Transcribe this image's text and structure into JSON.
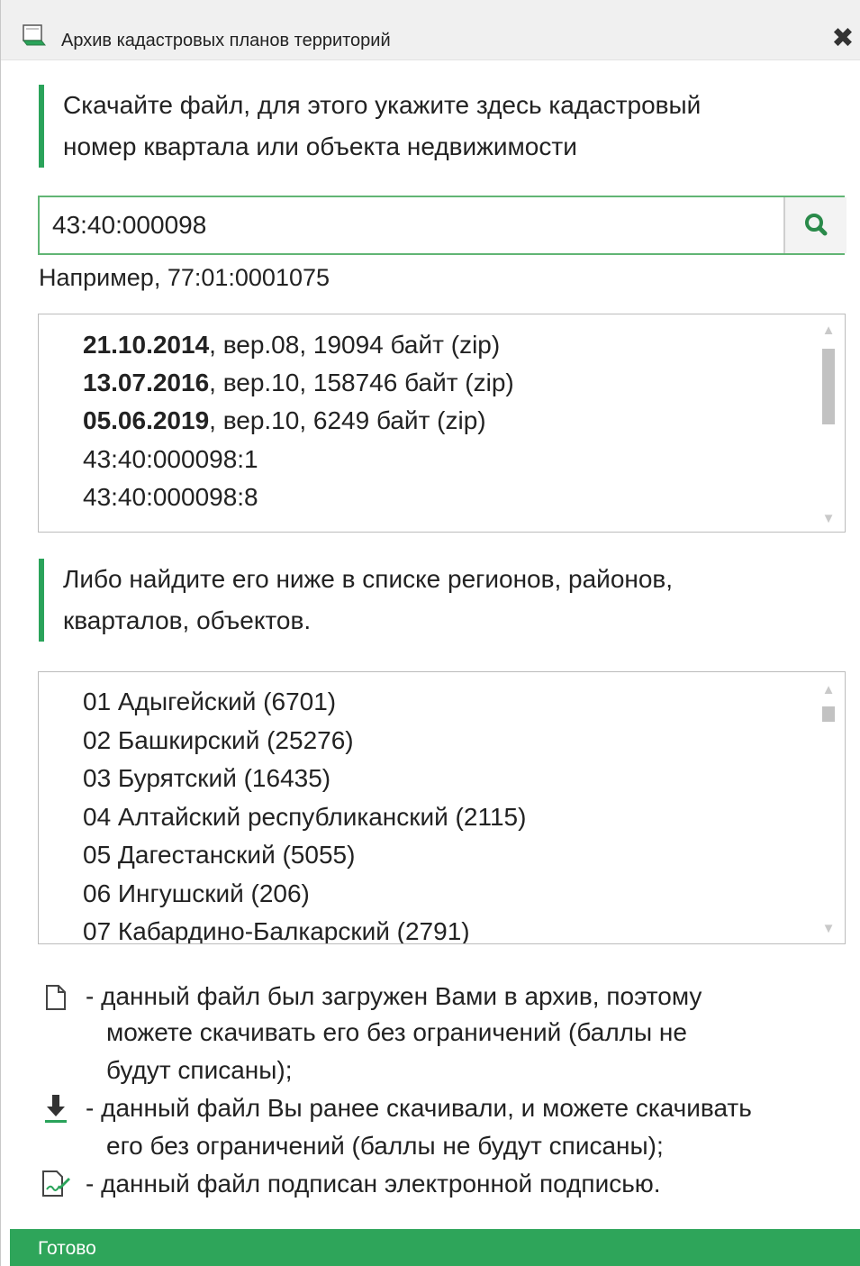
{
  "window": {
    "title": "Архив кадастровых планов территорий",
    "title_icon": "map-archive-icon",
    "close_icon": "close-icon",
    "close_glyph": "✖"
  },
  "instruction_1": {
    "line1": "Скачайте файл, для этого укажите здесь кадастровый",
    "line2": "номер квартала или объекта недвижимости"
  },
  "search": {
    "value": "43:40:000098",
    "button_icon": "search-icon",
    "hint": "Например, 77:01:0001075"
  },
  "results": {
    "items": [
      {
        "date": "21.10.2014",
        "rest": ", вер.08, 19094 байт (zip)"
      },
      {
        "date": "13.07.2016",
        "rest": ", вер.10, 158746 байт (zip)"
      },
      {
        "date": "05.06.2019",
        "rest": ", вер.10, 6249 байт (zip)"
      },
      {
        "date": "",
        "rest": "43:40:000098:1"
      },
      {
        "date": "",
        "rest": "43:40:000098:8"
      }
    ]
  },
  "instruction_2": {
    "line1": "Либо найдите его ниже в списке регионов, районов,",
    "line2": "кварталов, объектов."
  },
  "regions": {
    "items": [
      "01 Адыгейский (6701)",
      "02 Башкирский (25276)",
      "03 Бурятский (16435)",
      "04 Алтайский республиканский (2115)",
      "05 Дагестанский (5055)",
      "06 Ингушский (206)",
      "07 Кабардино-Балкарский (2791)"
    ]
  },
  "legend": {
    "uploaded": {
      "icon": "document-icon",
      "line1": "- данный файл был загружен Вами в архив, поэтому",
      "line2": "можете скачивать его без ограничений (баллы не",
      "line3": "будут списаны);"
    },
    "downloaded": {
      "icon": "download-icon",
      "line1": "- данный файл Вы ранее скачивали, и можете скачивать",
      "line2": "его без ограничений (баллы не будут списаны);"
    },
    "signed": {
      "icon": "signed-document-icon",
      "line1": "- данный файл подписан электронной подписью."
    }
  },
  "status": {
    "text": "Готово",
    "color": "#2ea55a"
  },
  "colors": {
    "accent": "#2aa35a",
    "search_icon": "#2a8a4a"
  }
}
